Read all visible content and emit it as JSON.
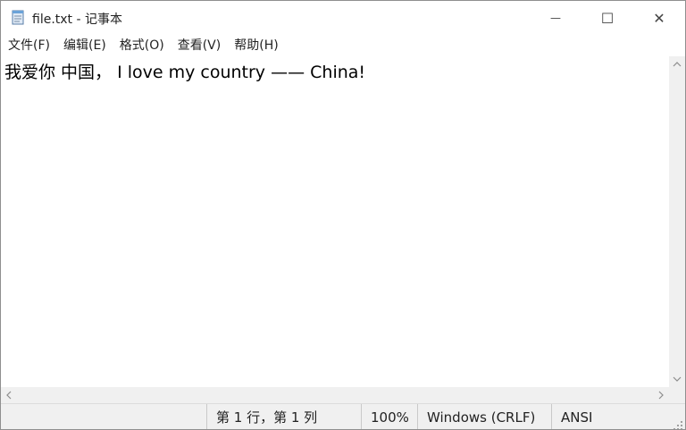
{
  "window": {
    "title": "file.txt - 记事本",
    "minimize_glyph": "—",
    "maximize_glyph": "☐",
    "close_glyph": "✕"
  },
  "menu": {
    "items": [
      {
        "label": "文件(F)"
      },
      {
        "label": "编辑(E)"
      },
      {
        "label": "格式(O)"
      },
      {
        "label": "查看(V)"
      },
      {
        "label": "帮助(H)"
      }
    ]
  },
  "editor": {
    "content": "我爱你 中国， I love my country —— China!"
  },
  "status": {
    "position": "第 1 行，第 1 列",
    "zoom": "100%",
    "line_ending": "Windows (CRLF)",
    "encoding": "ANSI"
  },
  "icons": {
    "app": "notepad-icon",
    "scroll_up": "chevron-up-icon",
    "scroll_down": "chevron-down-icon",
    "scroll_left": "chevron-left-icon",
    "scroll_right": "chevron-right-icon",
    "grip": "resize-grip-icon"
  },
  "colors": {
    "titlebar_bg": "#ffffff",
    "scrollbar_bg": "#f0f0f0",
    "statusbar_bg": "#f0f0f0",
    "text": "#000000"
  }
}
